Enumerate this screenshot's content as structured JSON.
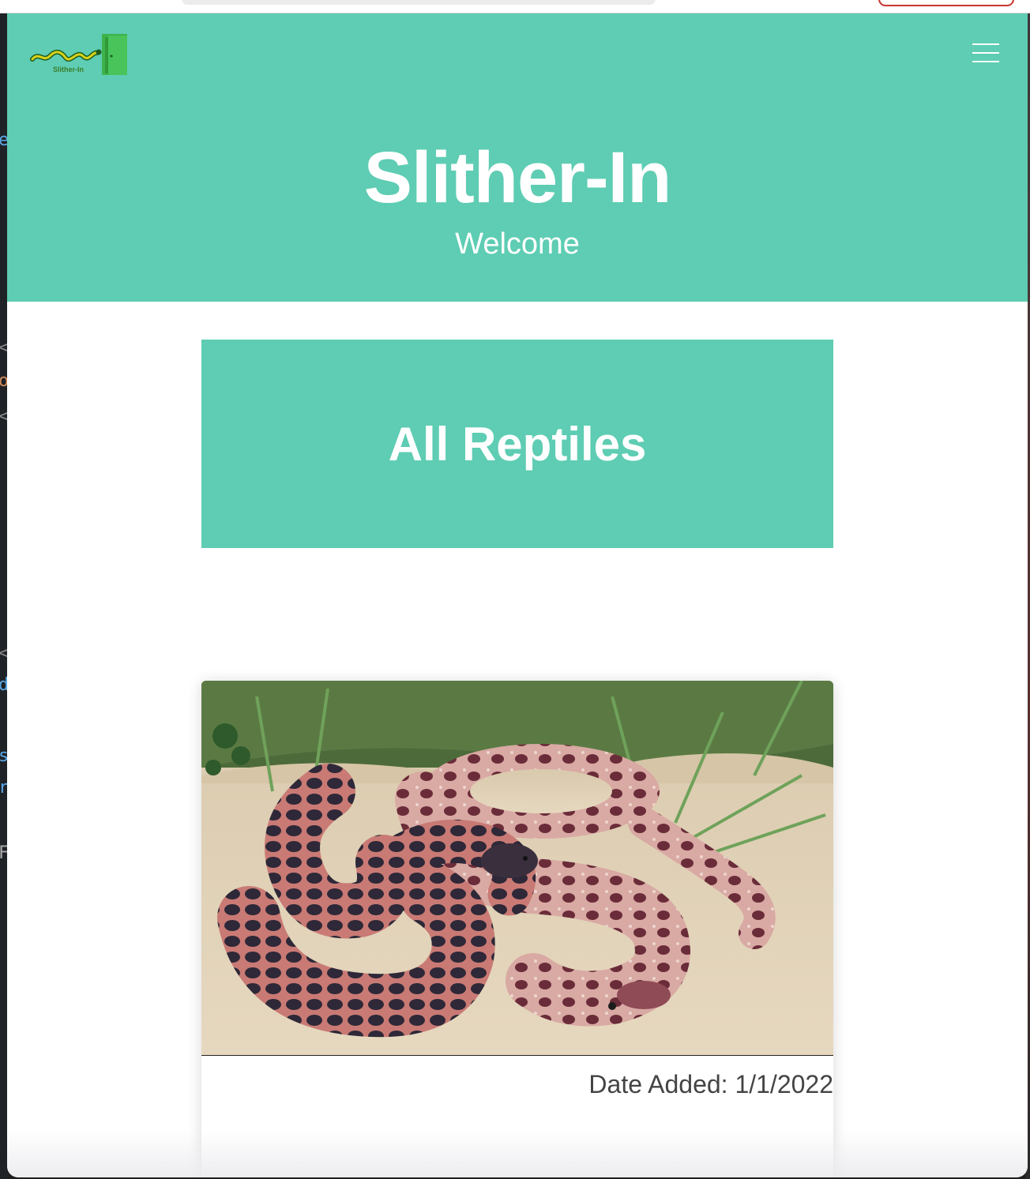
{
  "header": {
    "logo_text": "Slither-In",
    "title": "Slither-In",
    "subtitle": "Welcome",
    "menu_icon": "hamburger-menu-icon"
  },
  "section": {
    "title": "All Reptiles"
  },
  "cards": [
    {
      "image_description_icon": "snake-photo",
      "date_added": "Date Added: 1/1/2022"
    }
  ],
  "colors": {
    "brand_teal": "#5ecdb3",
    "text_white": "#ffffff",
    "date_text": "#444444"
  }
}
